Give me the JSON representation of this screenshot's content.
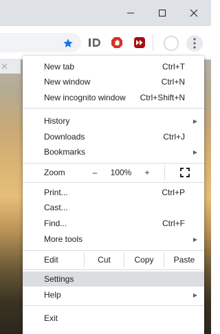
{
  "colors": {
    "accent_blue": "#1a73e8",
    "menu_hover": "#dcdde0",
    "red_ext": "#d93025",
    "dark_red_ext": "#a50e0e"
  },
  "window_controls": {
    "minimize": "minimize-icon",
    "maximize": "maximize-icon",
    "close": "close-icon"
  },
  "toolbar": {
    "bookmark_star": "star-icon",
    "extensions": [
      "id-extension-icon",
      "adblock-extension-icon",
      "video-extension-icon"
    ],
    "profile": "avatar",
    "menu": "more-vert-icon"
  },
  "menu": {
    "new_tab": {
      "label": "New tab",
      "shortcut": "Ctrl+T"
    },
    "new_window": {
      "label": "New window",
      "shortcut": "Ctrl+N"
    },
    "new_incognito": {
      "label": "New incognito window",
      "shortcut": "Ctrl+Shift+N"
    },
    "history": {
      "label": "History"
    },
    "downloads": {
      "label": "Downloads",
      "shortcut": "Ctrl+J"
    },
    "bookmarks": {
      "label": "Bookmarks"
    },
    "zoom": {
      "label": "Zoom",
      "minus": "–",
      "value": "100%",
      "plus": "+"
    },
    "print": {
      "label": "Print...",
      "shortcut": "Ctrl+P"
    },
    "cast": {
      "label": "Cast..."
    },
    "find": {
      "label": "Find...",
      "shortcut": "Ctrl+F"
    },
    "more_tools": {
      "label": "More tools"
    },
    "edit": {
      "label": "Edit",
      "cut": "Cut",
      "copy": "Copy",
      "paste": "Paste"
    },
    "settings": {
      "label": "Settings"
    },
    "help": {
      "label": "Help"
    },
    "exit": {
      "label": "Exit"
    }
  }
}
